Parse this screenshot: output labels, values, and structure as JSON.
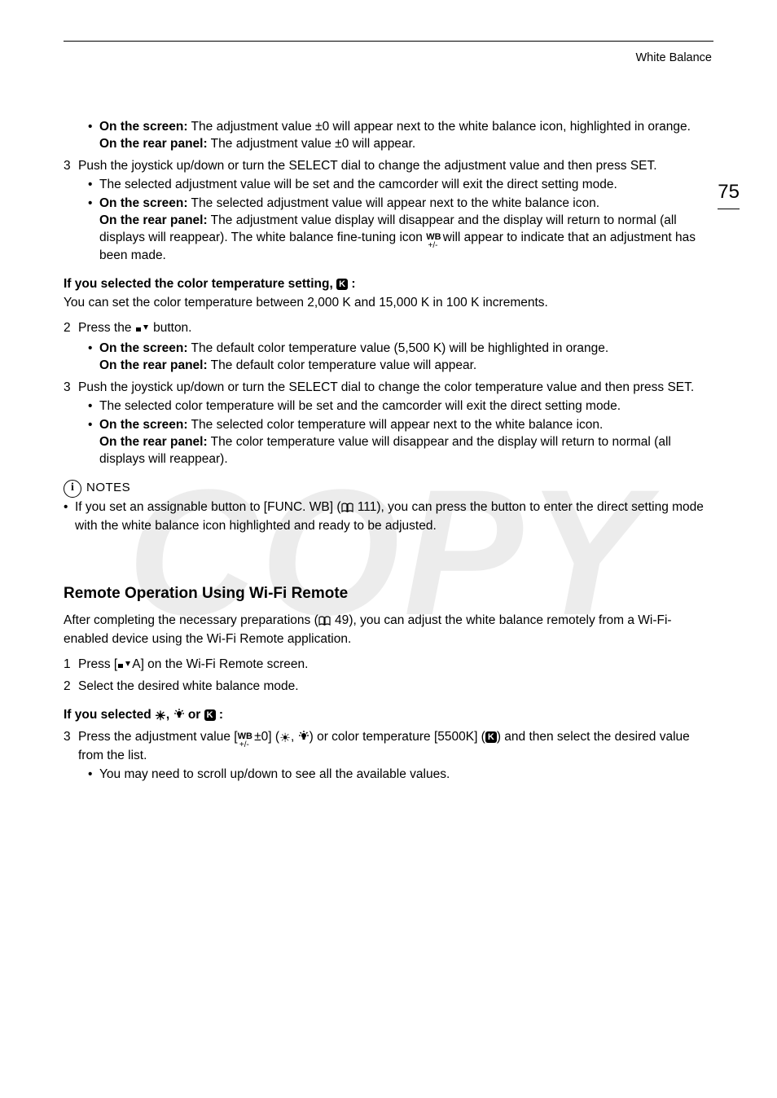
{
  "header": {
    "section": "White Balance"
  },
  "page_number": "75",
  "watermark": "COPY",
  "top_bullets": [
    {
      "screen_b": "On the screen:",
      "screen_t": " The adjustment value ±0 will appear next to the white balance icon, highlighted in orange.",
      "rear_b": "On the rear panel:",
      "rear_t": " The adjustment value ±0 will appear."
    }
  ],
  "step3": {
    "num": "3",
    "txt": "Push the joystick up/down or turn the SELECT dial to change the adjustment value and then press SET.",
    "bul1": "The selected adjustment value will be set and the camcorder will exit the direct setting mode.",
    "bul2_sb": "On the screen:",
    "bul2_st": " The selected adjustment value will appear next to the white balance icon.",
    "bul2_rb": "On the rear panel:",
    "bul2_rt_a": " The adjustment value display will disappear and the display will return to normal (all displays will reappear). The white balance fine-tuning icon ",
    "bul2_rt_b": " will appear to indicate that an adjustment has been made."
  },
  "ct_head_a": "If you selected the color temperature setting, ",
  "ct_head_b": " :",
  "ct_para": "You can set the color temperature between 2,000 K and 15,000 K in 100 K increments.",
  "ct_step2": {
    "num": "2",
    "a": "Press the ",
    "b": " button."
  },
  "ct_step2_bul_sb": "On the screen:",
  "ct_step2_bul_st": " The default color temperature value (5,500 K) will be highlighted in orange.",
  "ct_step2_bul_rb": "On the rear panel:",
  "ct_step2_bul_rt": " The default color temperature value will appear.",
  "ct_step3": {
    "num": "3",
    "txt": "Push the joystick up/down or turn the SELECT dial to change the color temperature value and then press SET.",
    "bul1": "The selected color temperature will be set and the camcorder will exit the direct setting mode.",
    "bul2_sb": "On the screen:",
    "bul2_st": " The selected color temperature will appear next to the white balance icon.",
    "bul2_rb": "On the rear panel:",
    "bul2_rt": " The color temperature value will disappear and the display will return to normal (all displays will reappear)."
  },
  "notes_label": "NOTES",
  "notes_bullet_a": "If you set an assignable button to [FUNC. WB] (",
  "notes_ref": " 111",
  "notes_bullet_b": "), you can press the button to enter the direct setting mode with the white balance icon highlighted and ready to be adjusted.",
  "remote_heading": "Remote Operation Using Wi-Fi Remote",
  "remote_para_a": "After completing the necessary preparations (",
  "remote_ref": " 49",
  "remote_para_b": "), you can adjust the white balance remotely from a Wi-Fi-enabled device using the Wi-Fi Remote application.",
  "r_step1": {
    "num": "1",
    "a": "Press [",
    "b": "A] on the Wi-Fi Remote screen."
  },
  "r_step2": {
    "num": "2",
    "txt": "Select the desired white balance mode."
  },
  "r_head_a": "If you selected ",
  "r_head_b": ", ",
  "r_head_c": " or ",
  "r_head_d": " :",
  "r_step3": {
    "num": "3",
    "a": "Press the adjustment value [",
    "b": " ±0] (",
    "c": ", ",
    "d": ") or color temperature [5500K] (",
    "e": ") and then select the desired value from the list."
  },
  "r_step3_bul": "You may need to scroll up/down to see all the available values."
}
